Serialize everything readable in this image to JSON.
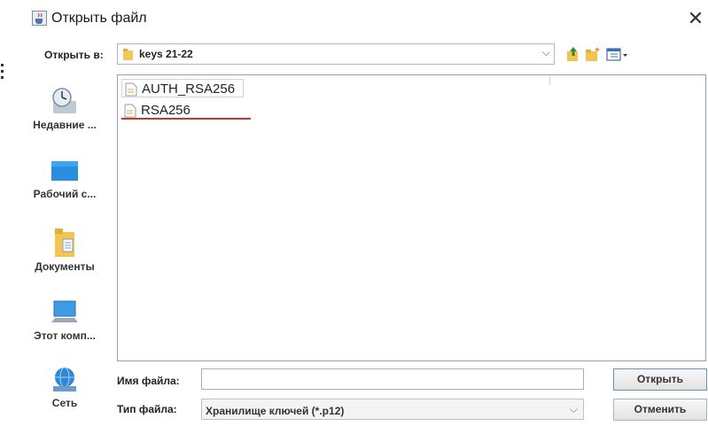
{
  "window": {
    "title": "Открыть файл",
    "close_glyph": "✕",
    "icon": "java-cup-icon"
  },
  "look_in": {
    "label": "Открыть в:",
    "value": "keys 21-22",
    "arrow": "⌵"
  },
  "toolbar": {
    "icons": [
      "up-folder-icon",
      "new-folder-icon",
      "view-menu-icon"
    ]
  },
  "places": [
    {
      "label": "Недавние ...",
      "icon": "recent-icon"
    },
    {
      "label": "Рабочий с...",
      "icon": "desktop-icon"
    },
    {
      "label": "Документы",
      "icon": "documents-icon"
    },
    {
      "label": "Этот комп...",
      "icon": "computer-icon"
    },
    {
      "label": "Сеть",
      "icon": "network-icon"
    }
  ],
  "files": [
    {
      "name": "AUTH_RSA256"
    },
    {
      "name": "RSA256"
    }
  ],
  "file_name": {
    "label": "Имя файла:",
    "value": ""
  },
  "file_type": {
    "label": "Тип файла:",
    "value": "Хранилище ключей (*.p12)",
    "arrow": "⌵"
  },
  "buttons": {
    "open": "Открыть",
    "cancel": "Отменить"
  },
  "colors": {
    "annotation_underline": "#c0392b",
    "list_border": "#8fa3b8"
  }
}
